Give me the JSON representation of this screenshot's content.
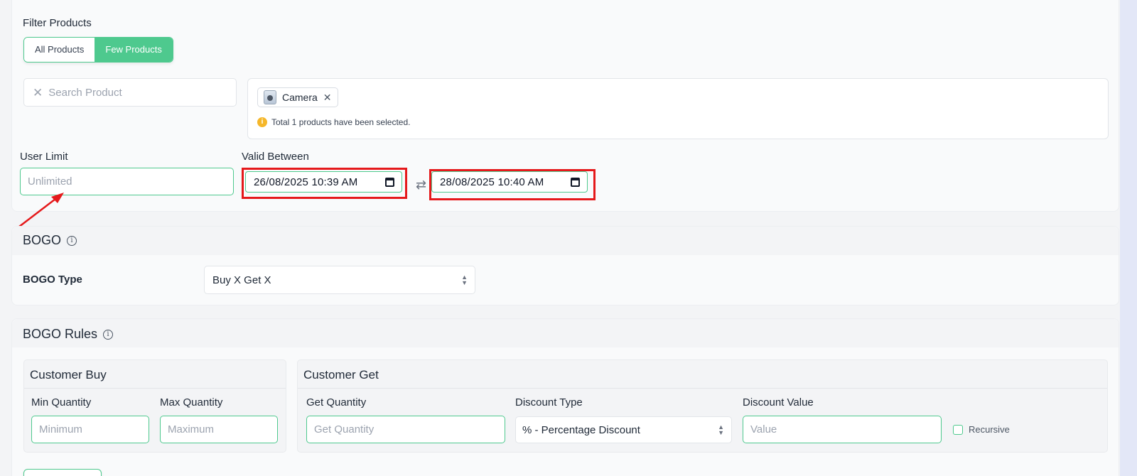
{
  "filter": {
    "title": "Filter Products",
    "options": [
      "All Products",
      "Few Products"
    ],
    "selected": "Few Products",
    "search_placeholder": "Search Product",
    "selected_product": "Camera",
    "selected_note": "Total 1 products have been selected."
  },
  "user_limit": {
    "label": "User Limit",
    "placeholder": "Unlimited"
  },
  "valid_between": {
    "label": "Valid Between",
    "start": "26/08/2025 10:39 AM",
    "end": "28/08/2025 10:40 AM"
  },
  "bogo": {
    "title": "BOGO",
    "type_label": "BOGO Type",
    "type_value": "Buy X Get X"
  },
  "rules": {
    "title": "BOGO Rules",
    "customer_buy": {
      "title": "Customer Buy",
      "min_label": "Min Quantity",
      "min_placeholder": "Minimum",
      "max_label": "Max Quantity",
      "max_placeholder": "Maximum"
    },
    "customer_get": {
      "title": "Customer Get",
      "get_label": "Get Quantity",
      "get_placeholder": "Get Quantity",
      "discount_type_label": "Discount Type",
      "discount_type_value": "% - Percentage Discount",
      "discount_value_label": "Discount Value",
      "discount_value_placeholder": "Value",
      "recursive_label": "Recursive"
    }
  },
  "colors": {
    "accent": "#4ec98e",
    "highlight": "#e5191b",
    "info": "#f5b72a"
  }
}
